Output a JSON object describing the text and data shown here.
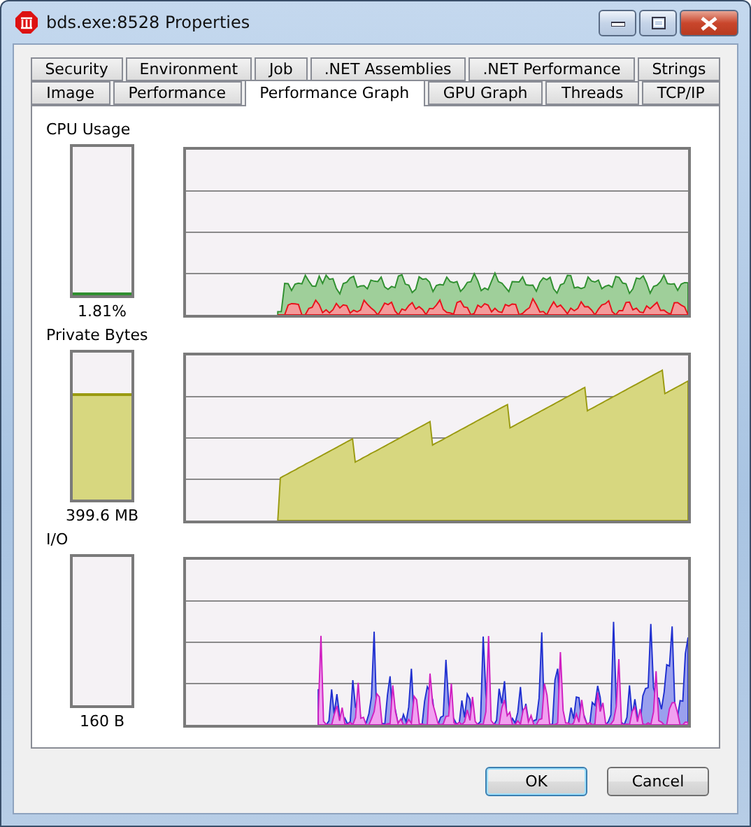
{
  "window": {
    "title": "bds.exe:8528 Properties"
  },
  "tab_rows": [
    [
      {
        "label": "Security",
        "selected": false
      },
      {
        "label": "Environment",
        "selected": false
      },
      {
        "label": "Job",
        "selected": false
      },
      {
        "label": ".NET Assemblies",
        "selected": false
      },
      {
        "label": ".NET Performance",
        "selected": false
      },
      {
        "label": "Strings",
        "selected": false
      }
    ],
    [
      {
        "label": "Image",
        "selected": false
      },
      {
        "label": "Performance",
        "selected": false
      },
      {
        "label": "Performance Graph",
        "selected": true
      },
      {
        "label": "GPU Graph",
        "selected": false
      },
      {
        "label": "Threads",
        "selected": false
      },
      {
        "label": "TCP/IP",
        "selected": false
      }
    ]
  ],
  "sections": [
    {
      "kind": "cpu",
      "label": "CPU Usage",
      "level": 0.0181,
      "reading": "1.81%"
    },
    {
      "kind": "memory",
      "label": "Private Bytes",
      "level": 0.72,
      "reading": "399.6 MB"
    },
    {
      "kind": "io",
      "label": "I/O",
      "reading": "160 B"
    }
  ],
  "buttons": [
    {
      "label": "OK",
      "default": true
    },
    {
      "label": "Cancel",
      "default": false
    }
  ]
}
